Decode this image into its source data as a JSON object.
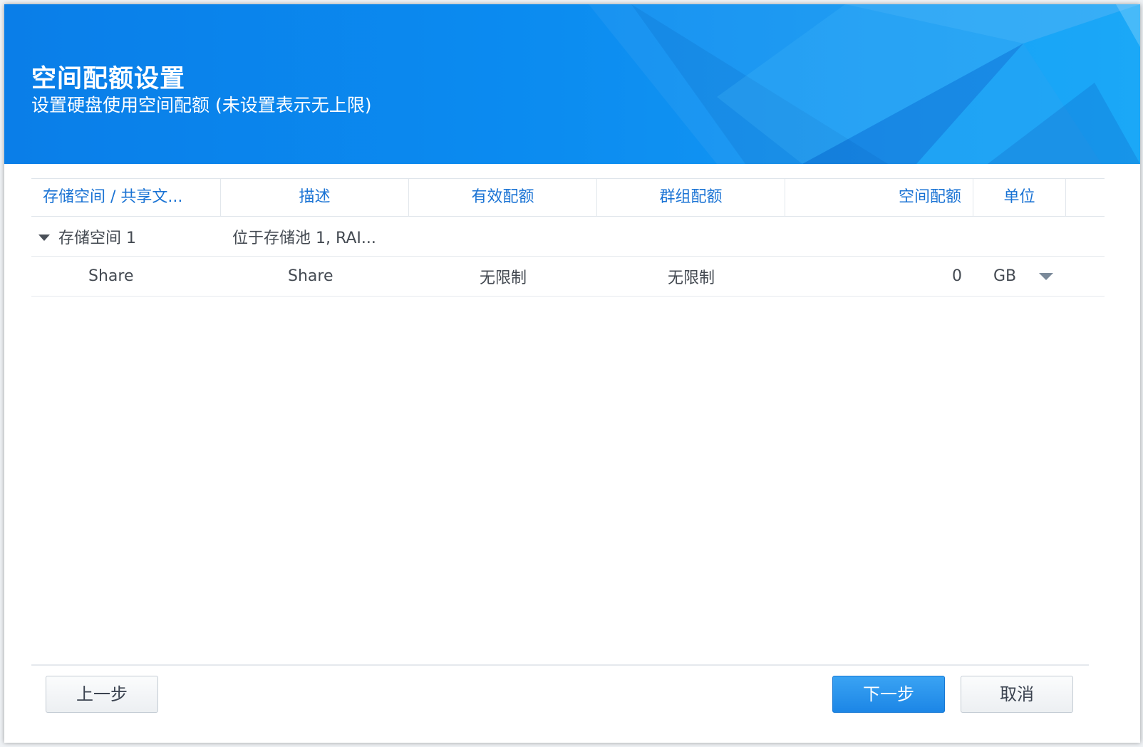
{
  "dialog": {
    "title": "空间配额设置",
    "subtitle": "设置硬盘使用空间配额 (未设置表示无上限)"
  },
  "table": {
    "headers": {
      "name": "存储空间 / 共享文...",
      "description": "描述",
      "effective_quota": "有效配额",
      "group_quota": "群组配额",
      "space_quota": "空间配额",
      "unit": "单位"
    },
    "volume_row": {
      "name": "存储空间 1",
      "description": "位于存储池 1, RAI..."
    },
    "share_row": {
      "name": "Share",
      "description": "Share",
      "effective_quota": "无限制",
      "group_quota": "无限制",
      "space_quota": "0",
      "unit": "GB"
    }
  },
  "buttons": {
    "back": "上一步",
    "next": "下一步",
    "cancel": "取消"
  },
  "colors": {
    "banner": "#0b8bf0",
    "header_text": "#1a73d4",
    "primary_button": "#1c86e6"
  }
}
